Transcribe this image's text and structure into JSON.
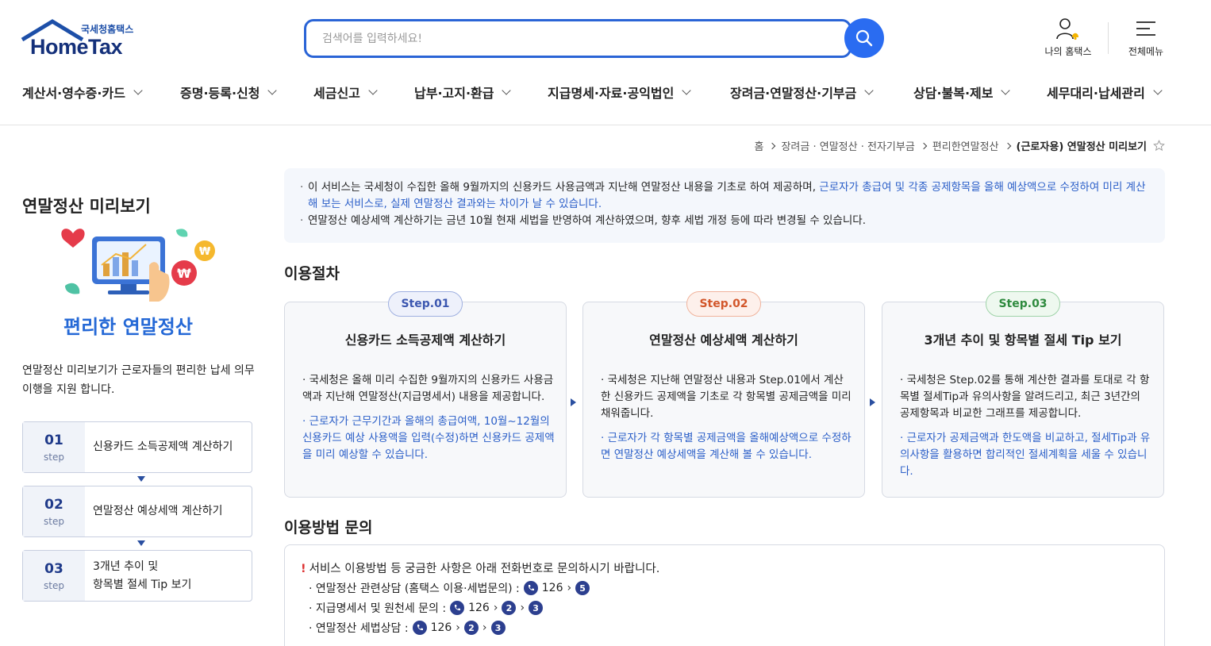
{
  "header": {
    "logo_small": "국세청홈택스",
    "logo_main": "HomeTax",
    "search_placeholder": "검색어를 입력하세요!",
    "my_hometax": "나의 홈택스",
    "all_menu": "전체메뉴",
    "accent": "#2a6cf1"
  },
  "gnb": [
    "계산서·영수증·카드",
    "증명·등록·신청",
    "세금신고",
    "납부·고지·환급",
    "지급명세·자료·공익법인",
    "장려금·연말정산·기부금",
    "상담·불복·제보",
    "세무대리·납세관리"
  ],
  "breadcrumb": {
    "items": [
      "홈",
      "장려금 · 연말정산 · 전자기부금",
      "편리한연말정산"
    ],
    "current": "(근로자용) 연말정산 미리보기"
  },
  "side": {
    "title": "연말정산 미리보기",
    "illus_title": "편리한 연말정산",
    "desc": "연말정산 미리보기가 근로자들의  편리한 납세 의무 이행을 지원 합니다.",
    "steps": [
      {
        "num": "01",
        "label": "step",
        "text": "신용카드 소득공제액 계산하기"
      },
      {
        "num": "02",
        "label": "step",
        "text": "연말정산 예상세액 계산하기"
      },
      {
        "num": "03",
        "label": "step",
        "text_line1": "3개년 추이 및",
        "text_line2": "항목별 절세 Tip 보기"
      }
    ]
  },
  "notice": {
    "line1_a": "이 서비스는 국세청이 수집한 올해 9월까지의 신용카드 사용금액과 지난해 연말정산 내용을 기초로 하여 제공하며, ",
    "line1_b": "근로자가 총급여 및 각종 공제항목을 올해 예상액으로 수정하여 미리 계산해 보는 서비스로, 실제 연말정산 결과와는 차이가 날 수 있습니다.",
    "line2": "연말정산 예상세액 계산하기는 금년 10월 현재 세법을 반영하여 계산하였으며, 향후 세법 개정 등에 따라 변경될 수 있습니다."
  },
  "procedure": {
    "title": "이용절차",
    "cards": [
      {
        "pill": "Step.01",
        "pill_color": "#3c57b0",
        "pill_bg": "#eef1fb",
        "title": "신용카드 소득공제액 계산하기",
        "body": "· 국세청은 올해 미리 수집한 9월까지의 신용카드 사용금액과 지난해 연말정산(지급명세서) 내용을 제공합니다.",
        "blue": "· 근로자가 근무기간과 올해의 총급여액, 10월~12월의 신용카드 예상 사용액을 입력(수정)하면 신용카드 공제액을 미리 예상할 수 있습니다."
      },
      {
        "pill": "Step.02",
        "pill_color": "#d2562a",
        "pill_bg": "#fdf0eb",
        "title": "연말정산 예상세액 계산하기",
        "body": "· 국세청은 지난해 연말정산 내용과 Step.01에서 계산한 신용카드 공제액을 기초로 각 항목별 공제금액을 미리 채워줍니다.",
        "blue": "· 근로자가 각 항목별 공제금액을 올해예상액으로 수정하면 연말정산 예상세액을 계산해 볼 수 있습니다."
      },
      {
        "pill": "Step.03",
        "pill_color": "#2e8a3e",
        "pill_bg": "#eef8ef",
        "title": "3개년 추이 및 항목별 절세 Tip 보기",
        "body": "· 국세청은 Step.02를 통해 계산한 결과를 토대로 각 항목별 절세Tip과 유의사항을 알려드리고, 최근 3년간의 공제항목과 비교한 그래프를 제공합니다.",
        "blue": "· 근로자가 공제금액과 한도액을 비교하고, 절세Tip과 유의사항을 활용하면 합리적인 절세계획을 세울 수 있습니다."
      }
    ]
  },
  "contact": {
    "title": "이용방법 문의",
    "head": "서비스 이용방법 등 궁금한 사항은 아래 전화번호로 문의하시기 바랍니다.",
    "rows": [
      {
        "label": "· 연말정산 관련상담 (홈택스 이용·세법문의) :",
        "number": "126",
        "seq": [
          "5"
        ]
      },
      {
        "label": "· 지급명세서 및 원천세 문의 :",
        "number": "126",
        "seq": [
          "2",
          "3"
        ]
      },
      {
        "label": "· 연말정산 세법상담 :",
        "number": "126",
        "seq": [
          "2",
          "3"
        ]
      }
    ]
  }
}
